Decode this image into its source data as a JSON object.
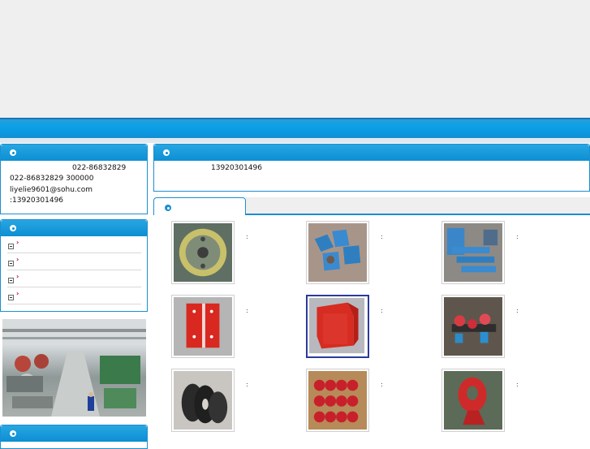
{
  "contact": {
    "line1": "022-86832829",
    "line2": "022-86832829    300000",
    "line3": "liyelie9601@sohu.com",
    "line4": ":13920301496"
  },
  "notice": {
    "phone": "13920301496"
  },
  "menu": {
    "items": [
      "›",
      "›",
      "›",
      "›"
    ]
  },
  "products": {
    "items": [
      {
        "icon": "wheel-product-photo",
        "colon": ":"
      },
      {
        "icon": "blue-molds-product-photo",
        "colon": ":"
      },
      {
        "icon": "blue-trays-product-photo",
        "colon": ":"
      },
      {
        "icon": "red-box-product-photo",
        "colon": ":"
      },
      {
        "icon": "red-cabinet-product-photo",
        "colon": ":"
      },
      {
        "icon": "red-rollers-product-photo",
        "colon": ":"
      },
      {
        "icon": "black-gears-product-photo",
        "colon": ":"
      },
      {
        "icon": "red-wheels-product-photo",
        "colon": ":"
      },
      {
        "icon": "red-hook-product-photo",
        "colon": ":"
      }
    ]
  },
  "colors": {
    "accent": "#0c8fd3",
    "border": "#1b8fd0",
    "header_bg": "#efefef"
  }
}
